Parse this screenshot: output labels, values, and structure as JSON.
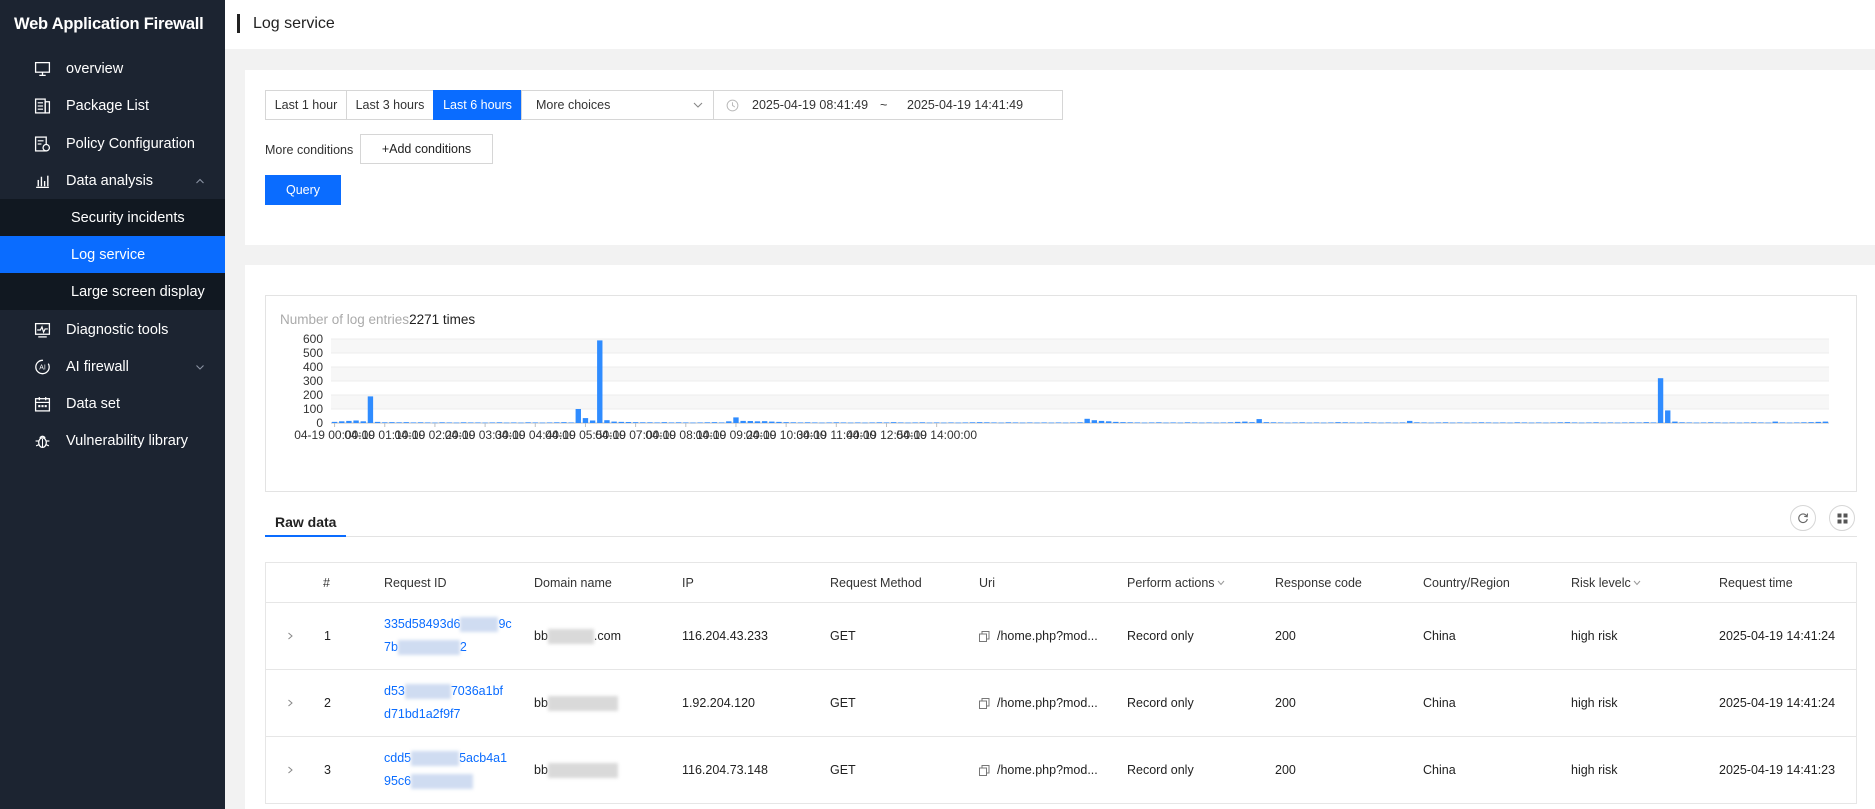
{
  "app": {
    "title": "Web Application Firewall"
  },
  "sidebar": {
    "items": [
      {
        "label": "overview",
        "icon": "monitor-icon"
      },
      {
        "label": "Package List",
        "icon": "list-icon"
      },
      {
        "label": "Policy Configuration",
        "icon": "policy-icon"
      },
      {
        "label": "Data analysis",
        "icon": "chart-icon",
        "expanded": true,
        "children": [
          {
            "label": "Security incidents"
          },
          {
            "label": "Log service",
            "active": true
          },
          {
            "label": "Large screen display"
          }
        ]
      },
      {
        "label": "Diagnostic tools",
        "icon": "diagnostic-icon"
      },
      {
        "label": "AI firewall",
        "icon": "ai-icon",
        "expanded": false
      },
      {
        "label": "Data set",
        "icon": "calendar-icon"
      },
      {
        "label": "Vulnerability library",
        "icon": "bug-icon"
      }
    ]
  },
  "header": {
    "title": "Log service"
  },
  "query": {
    "ranges": [
      "Last 1 hour",
      "Last 3 hours",
      "Last 6 hours"
    ],
    "active_range": "Last 6 hours",
    "more_choices": "More choices",
    "date_start": "2025-04-19 08:41:49",
    "date_sep": "~",
    "date_end": "2025-04-19 14:41:49",
    "more_conditions_label": "More conditions",
    "add_conditions": "+Add conditions",
    "query_button": "Query"
  },
  "summary": {
    "label": "Number of log entries",
    "count": "2271 times"
  },
  "chart_data": {
    "type": "bar",
    "title": "",
    "xlabel": "",
    "ylabel": "",
    "ylim": [
      0,
      600
    ],
    "yticks": [
      0,
      100,
      200,
      300,
      400,
      500,
      600
    ],
    "grid": true,
    "color": "#2f8cff",
    "xtick_labels": [
      "04-19 00:00:00",
      "04-19 01:10:00",
      "04-19 02:20:00",
      "04-19 03:30:00",
      "04-19 04:40:00",
      "04-19 05:50:00",
      "04-19 07:00:00",
      "04-19 08:10:00",
      "04-19 09:20:00",
      "04-19 10:30:00",
      "04-19 11:40:00",
      "04-19 12:50:00",
      "04-19 14:00:00"
    ],
    "xtick_every": 7,
    "values": [
      8,
      12,
      15,
      18,
      12,
      190,
      8,
      5,
      6,
      5,
      6,
      4,
      5,
      4,
      3,
      5,
      4,
      3,
      5,
      4,
      4,
      3,
      4,
      5,
      3,
      4,
      3,
      5,
      4,
      3,
      4,
      5,
      6,
      4,
      100,
      35,
      18,
      590,
      20,
      10,
      8,
      7,
      6,
      5,
      5,
      4,
      6,
      4,
      5,
      4,
      3,
      4,
      5,
      6,
      4,
      12,
      40,
      15,
      14,
      12,
      13,
      10,
      8,
      6,
      5,
      4,
      5,
      4,
      3,
      4,
      5,
      4,
      3,
      4,
      3,
      4,
      5,
      4,
      6,
      4,
      3,
      4,
      5,
      3,
      4,
      3,
      4,
      3,
      4,
      5,
      6,
      5,
      4,
      3,
      5,
      4,
      3,
      4,
      3,
      4,
      3,
      4,
      3,
      4,
      5,
      30,
      20,
      15,
      12,
      8,
      6,
      5,
      4,
      3,
      4,
      5,
      3,
      4,
      3,
      5,
      4,
      3,
      4,
      3,
      4,
      5,
      8,
      10,
      6,
      28,
      6,
      5,
      4,
      3,
      4,
      5,
      3,
      4,
      3,
      4,
      6,
      5,
      4,
      3,
      5,
      4,
      3,
      4,
      3,
      4,
      15,
      5,
      4,
      3,
      4,
      5,
      3,
      4,
      3,
      4,
      5,
      4,
      3,
      4,
      3,
      5,
      4,
      3,
      4,
      3,
      4,
      5,
      6,
      4,
      3,
      4,
      5,
      3,
      4,
      3,
      4,
      5,
      4,
      6,
      4,
      320,
      90,
      10,
      5,
      4,
      3,
      4,
      5,
      4,
      3,
      4,
      3,
      4,
      5,
      4,
      3,
      10,
      4,
      3,
      4,
      5,
      6,
      8,
      10
    ]
  },
  "raw_tab": {
    "label": "Raw data"
  },
  "table": {
    "headers": {
      "num": "#",
      "request_id": "Request ID",
      "domain": "Domain name",
      "ip": "IP",
      "method": "Request Method",
      "uri": "Uri",
      "action": "Perform actions",
      "code": "Response code",
      "country": "Country/Region",
      "risk": "Risk levelc",
      "time": "Request time"
    },
    "rows": [
      {
        "num": "1",
        "req_id_a": "335d58493d6",
        "req_id_b": "9c",
        "req_id_c": "7b",
        "req_id_d": "2",
        "domain_a": "bb",
        "domain_b": ".com",
        "ip": "116.204.43.233",
        "method": "GET",
        "uri": "/home.php?mod...",
        "action": "Record only",
        "code": "200",
        "country": "China",
        "risk": "high risk",
        "time": "2025-04-19 14:41:24"
      },
      {
        "num": "2",
        "req_id_a": "d53",
        "req_id_b": "7036a1bf",
        "req_id_c": "d71bd1a2f9f7",
        "req_id_d": "",
        "domain_a": "bb",
        "domain_b": "",
        "ip": "1.92.204.120",
        "method": "GET",
        "uri": "/home.php?mod...",
        "action": "Record only",
        "code": "200",
        "country": "China",
        "risk": "high risk",
        "time": "2025-04-19 14:41:24"
      },
      {
        "num": "3",
        "req_id_a": "cdd5",
        "req_id_b": "5acb4a1",
        "req_id_c": "95c6",
        "req_id_d": "",
        "domain_a": "bb",
        "domain_b": "",
        "ip": "116.204.73.148",
        "method": "GET",
        "uri": "/home.php?mod...",
        "action": "Record only",
        "code": "200",
        "country": "China",
        "risk": "high risk",
        "time": "2025-04-19 14:41:23"
      }
    ]
  },
  "colors": {
    "sidebar_bg": "#1c2431",
    "accent": "#0a6cff",
    "submenu_bg": "#111821"
  }
}
